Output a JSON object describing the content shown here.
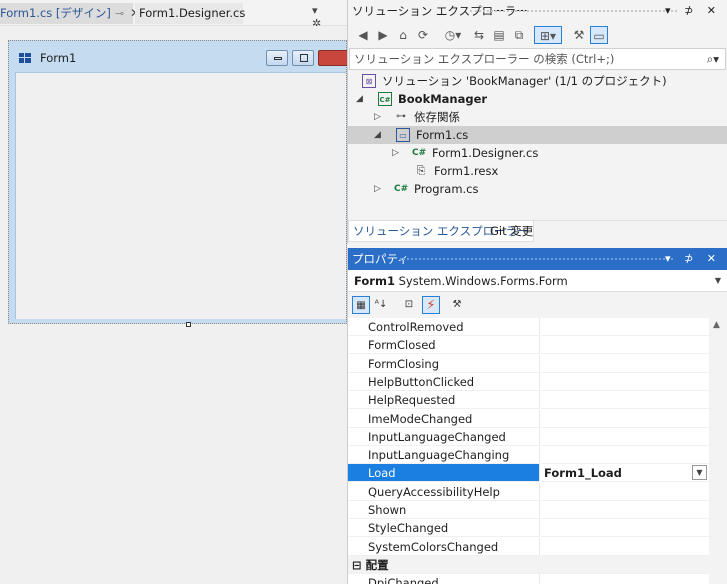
{
  "editor_tabs": {
    "active": "Form1.cs [デザイン]",
    "active_pin": "⊸",
    "active_close": "✕",
    "second": "Form1.Designer.cs",
    "tools": "▾ ✲"
  },
  "designer": {
    "form_title": "Form1"
  },
  "solution_explorer": {
    "title": "ソリューション エクスプローラー",
    "controls": "▾ ⊅ ✕",
    "search_placeholder": "ソリューション エクスプローラー の検索 (Ctrl+;)",
    "search_icon": "⌕▾",
    "toolbar": [
      "◀",
      "▶",
      "⌂",
      "⟳",
      "◷▾",
      "⇆",
      "▤",
      "⧉",
      "⊞▾",
      "⚒",
      "▭"
    ],
    "tree": [
      {
        "label": "ソリューション 'BookManager' (1/1 のプロジェクト)",
        "icon": "solution-icon",
        "glyph": "⊠",
        "arrow": ""
      },
      {
        "label": "BookManager",
        "icon": "csharp-project-icon",
        "glyph": "C#",
        "arrow": "◢"
      },
      {
        "label": "依存関係",
        "icon": "dependencies-icon",
        "glyph": "⊶",
        "arrow": "▷"
      },
      {
        "label": "Form1.cs",
        "icon": "form-file-icon",
        "glyph": "▭",
        "arrow": "◢"
      },
      {
        "label": "Form1.Designer.cs",
        "icon": "csharp-file-icon",
        "glyph": "C#",
        "arrow": "▷"
      },
      {
        "label": "Form1.resx",
        "icon": "resx-file-icon",
        "glyph": "⎘",
        "arrow": ""
      },
      {
        "label": "Program.cs",
        "icon": "csharp-file-icon",
        "glyph": "C#",
        "arrow": "▷"
      }
    ],
    "bottom_tabs": [
      "ソリューション エクスプローラー",
      "Git 変更"
    ]
  },
  "properties": {
    "title": "プロパティ",
    "controls": "▾ ⊅ ✕",
    "object_name": "Form1",
    "object_type": "System.Windows.Forms.Form",
    "toolbar": [
      "▦",
      "ᴬ↓",
      "⊡",
      "⚡",
      "⚒"
    ],
    "rows": [
      {
        "name": "ControlRemoved",
        "value": ""
      },
      {
        "name": "FormClosed",
        "value": ""
      },
      {
        "name": "FormClosing",
        "value": ""
      },
      {
        "name": "HelpButtonClicked",
        "value": ""
      },
      {
        "name": "HelpRequested",
        "value": ""
      },
      {
        "name": "ImeModeChanged",
        "value": ""
      },
      {
        "name": "InputLanguageChanged",
        "value": ""
      },
      {
        "name": "InputLanguageChanging",
        "value": ""
      },
      {
        "name": "Load",
        "value": "Form1_Load",
        "selected": true
      },
      {
        "name": "QueryAccessibilityHelp",
        "value": ""
      },
      {
        "name": "Shown",
        "value": ""
      },
      {
        "name": "StyleChanged",
        "value": ""
      },
      {
        "name": "SystemColorsChanged",
        "value": ""
      },
      {
        "name": "⊟ 配置",
        "value": "",
        "category": true
      },
      {
        "name": "DpiChanged",
        "value": ""
      }
    ]
  },
  "colors": {
    "accent": "#2b6ec8",
    "selection": "#1a7fe0"
  }
}
